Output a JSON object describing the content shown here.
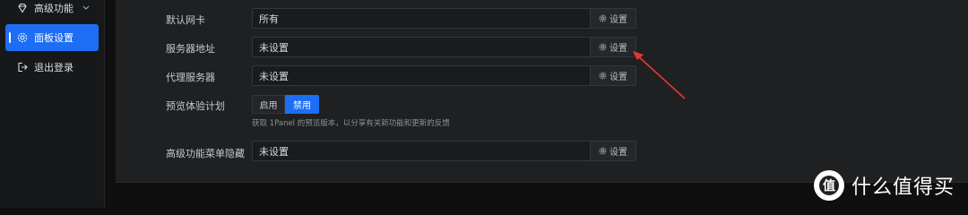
{
  "sidebar": {
    "items": [
      {
        "label": "高级功能",
        "icon": "diamond-icon"
      },
      {
        "label": "面板设置",
        "icon": "gear-icon",
        "active": true
      },
      {
        "label": "退出登录",
        "icon": "logout-icon"
      }
    ]
  },
  "settings": {
    "rows": [
      {
        "label": "默认网卡",
        "value": "所有",
        "button": "设置"
      },
      {
        "label": "服务器地址",
        "value": "未设置",
        "button": "设置"
      },
      {
        "label": "代理服务器",
        "value": "未设置",
        "button": "设置"
      },
      {
        "label": "高级功能菜单隐藏",
        "value": "未设置",
        "button": "设置"
      }
    ],
    "preview": {
      "label": "预览体验计划",
      "enable": "启用",
      "disable": "禁用",
      "selected": "禁用",
      "hint": "获取 1Panel 的预览版本，以分享有关新功能和更新的反馈"
    }
  },
  "watermark": {
    "logo_char": "值",
    "text": "什么值得买"
  },
  "colors": {
    "accent": "#1d6ef5",
    "annotation": "#e53935",
    "background": "#1f2021"
  }
}
